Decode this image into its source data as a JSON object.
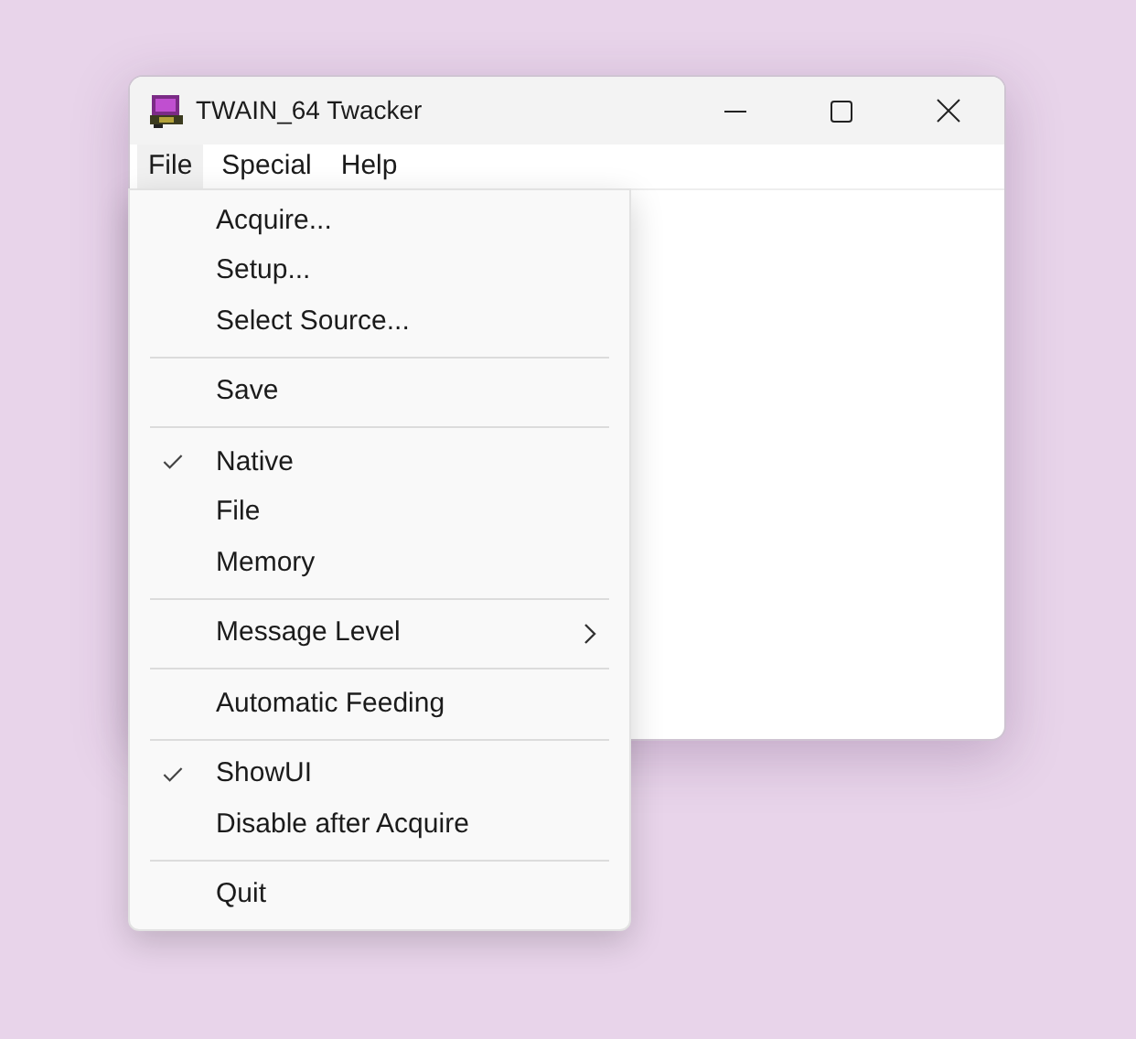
{
  "window": {
    "title": "TWAIN_64 Twacker"
  },
  "menu_bar": [
    {
      "label": "File",
      "selected": true
    },
    {
      "label": "Special",
      "selected": false
    },
    {
      "label": "Help",
      "selected": false
    }
  ],
  "menu": [
    {
      "kind": "item",
      "label": "Acquire...",
      "checked": false,
      "submenu": false
    },
    {
      "kind": "item",
      "label": "Setup...",
      "checked": false,
      "submenu": false
    },
    {
      "kind": "item",
      "label": "Select Source...",
      "checked": false,
      "submenu": false
    },
    {
      "kind": "separator"
    },
    {
      "kind": "item",
      "label": "Save",
      "checked": false,
      "submenu": false
    },
    {
      "kind": "separator"
    },
    {
      "kind": "item",
      "label": "Native",
      "checked": true,
      "submenu": false
    },
    {
      "kind": "item",
      "label": "File",
      "checked": false,
      "submenu": false
    },
    {
      "kind": "item",
      "label": "Memory",
      "checked": false,
      "submenu": false
    },
    {
      "kind": "separator"
    },
    {
      "kind": "item",
      "label": "Message Level",
      "checked": false,
      "submenu": true
    },
    {
      "kind": "separator"
    },
    {
      "kind": "item",
      "label": "Automatic Feeding",
      "checked": false,
      "submenu": false
    },
    {
      "kind": "separator"
    },
    {
      "kind": "item",
      "label": "ShowUI",
      "checked": true,
      "submenu": false
    },
    {
      "kind": "item",
      "label": "Disable after Acquire",
      "checked": false,
      "submenu": false
    },
    {
      "kind": "separator"
    },
    {
      "kind": "item",
      "label": "Quit",
      "checked": false,
      "submenu": false
    }
  ]
}
